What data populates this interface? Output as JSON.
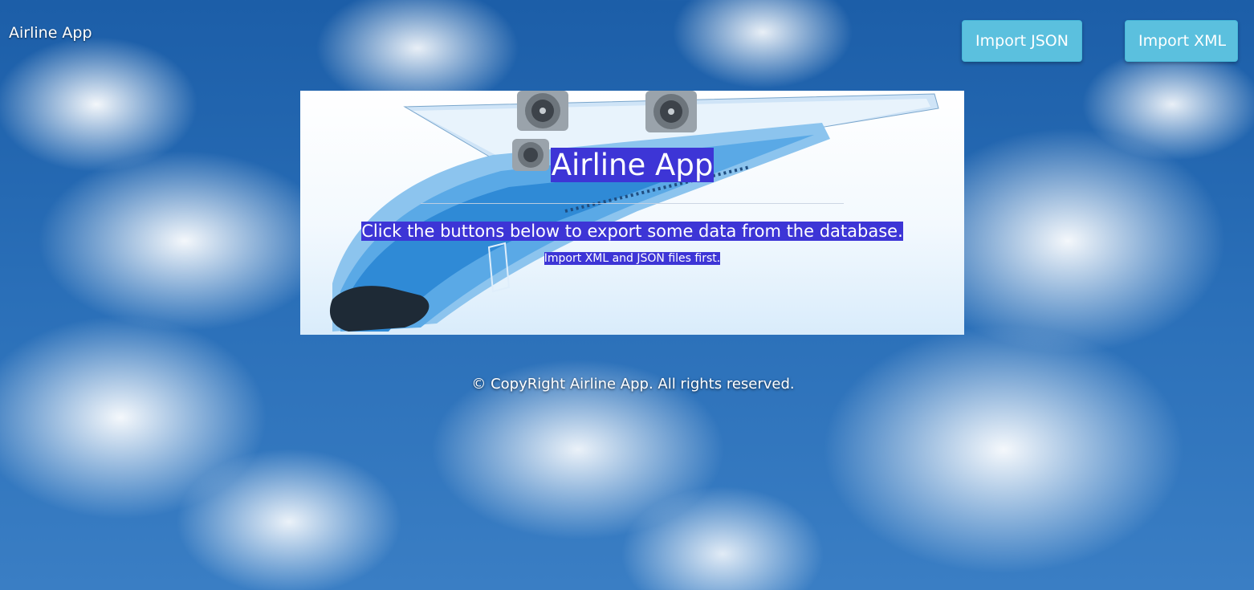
{
  "navbar": {
    "brand": "Airline App",
    "buttons": {
      "import_json": "Import JSON",
      "import_xml": "Import XML"
    }
  },
  "hero": {
    "title": "Airline App",
    "subtitle": "Click the buttons below to export some data from the database.",
    "note": "Import XML and JSON files first."
  },
  "footer": {
    "copyright": "© CopyRight Airline App. All rights reserved."
  },
  "colors": {
    "button": "#5bc0de",
    "highlight": "#3d35d6",
    "sky": "#2a6fb8"
  },
  "icons": {
    "background": "sky-clouds-image",
    "hero_image": "airplane-image"
  }
}
